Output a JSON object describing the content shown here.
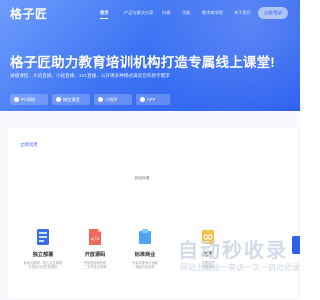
{
  "brand": {
    "logo": "格子匠"
  },
  "nav": {
    "items": [
      {
        "label": "首页",
        "active": true
      },
      {
        "label": "产品与解决方案",
        "active": false
      },
      {
        "label": "价格",
        "active": false
      },
      {
        "label": "功能",
        "active": false
      },
      {
        "label": "数字商学院",
        "active": false
      },
      {
        "label": "关于我们",
        "active": false
      }
    ],
    "cta_label": "注册/登录"
  },
  "hero": {
    "title": "格子匠助力教育培训机构打造专属线上课堂!",
    "subtitle": "录播课程、大班直播、小班直播、1V1直播、公开课多种模式满足您的教学需求",
    "buttons": [
      {
        "label": "PC网校"
      },
      {
        "label": "微信课堂"
      },
      {
        "label": "小程序"
      },
      {
        "label": "APP"
      }
    ]
  },
  "section": {
    "label": "立即试用",
    "center_text": "精品网课"
  },
  "features": [
    {
      "title": "独立部署",
      "desc_lines": [
        "私有化部署，独立定位网络",
        "打造自己的在线课堂"
      ]
    },
    {
      "title": "开放源码",
      "desc_lines": [
        "开放全部源代码",
        "二次开发无障碍"
      ]
    },
    {
      "title": "标准商业",
      "desc_lines": [
        "完善标准商业功能",
        "满足日常运营"
      ]
    },
    {
      "title": "无限",
      "desc_lines": [
        "无限学员",
        "无限课程"
      ]
    }
  ],
  "watermark": {
    "title": "自动秒收录",
    "subtitle": "网站上链接一来访一次一自动收录"
  },
  "colors": {
    "primary": "#2f62e8",
    "hero_light": "#6e9dfd",
    "accent_blue": "#3d6ee9"
  }
}
